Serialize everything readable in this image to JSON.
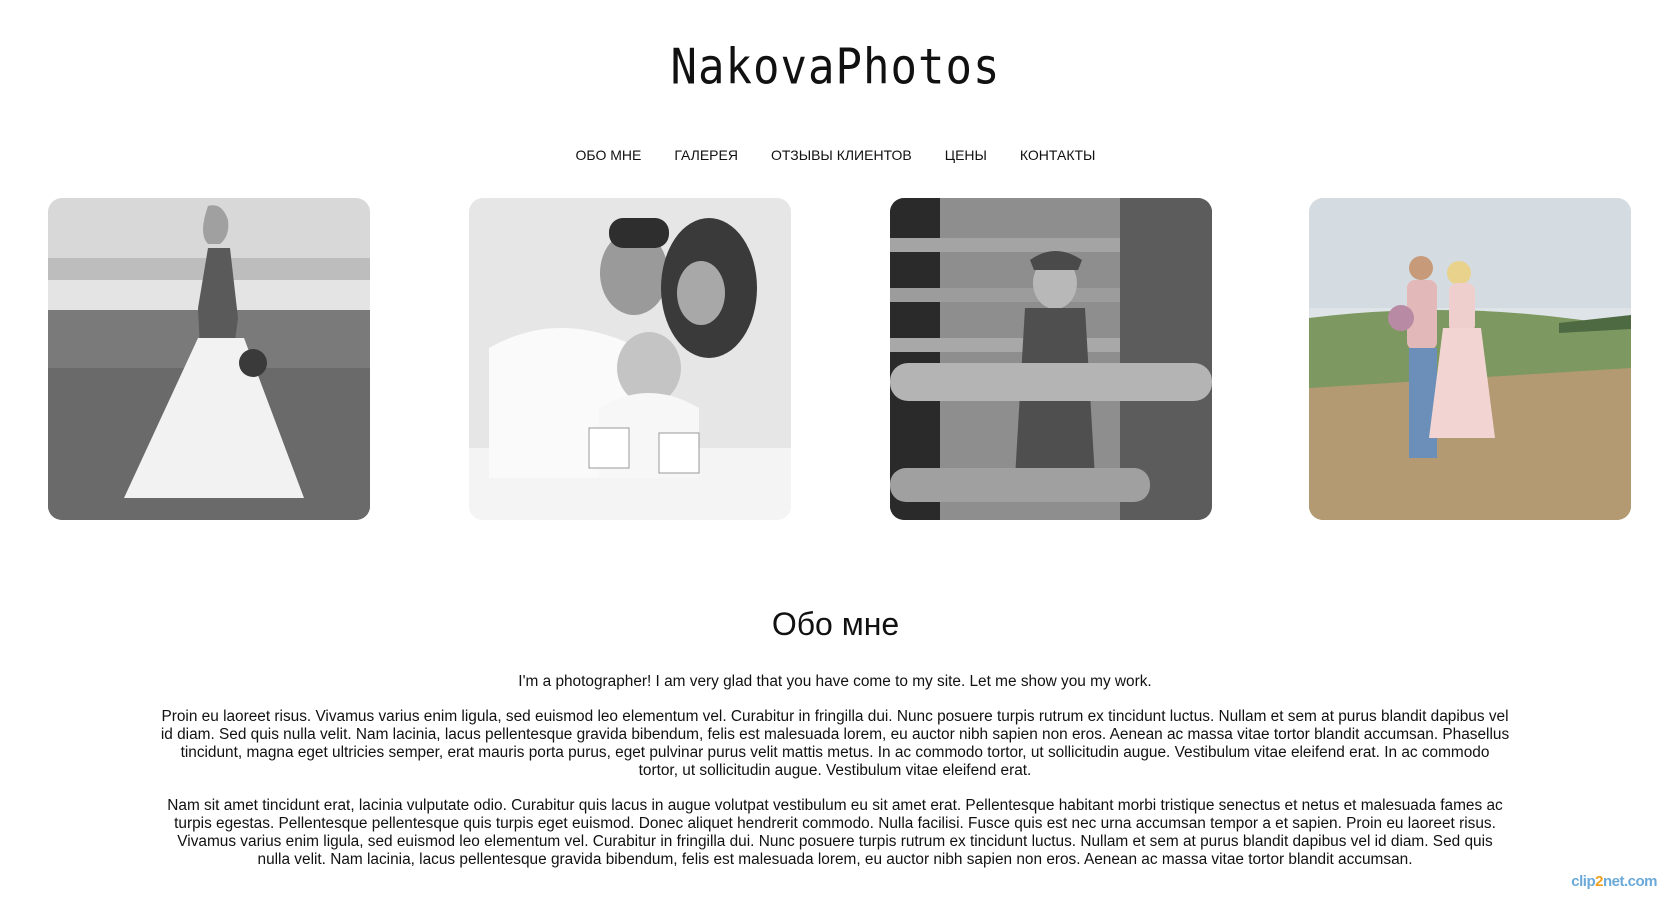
{
  "site": {
    "logo": "NakovaPhotos"
  },
  "nav": {
    "items": [
      {
        "label": "ОБО МНЕ"
      },
      {
        "label": "ГАЛЕРЕЯ"
      },
      {
        "label": "ОТЗЫВЫ КЛИЕНТОВ"
      },
      {
        "label": "ЦЕНЫ"
      },
      {
        "label": "КОНТАКТЫ"
      }
    ]
  },
  "gallery": {
    "photos": [
      {
        "icon": "bride-in-field-photo",
        "tone": "grayscale"
      },
      {
        "icon": "family-with-baby-photo",
        "tone": "grayscale"
      },
      {
        "icon": "woman-at-fence-photo",
        "tone": "grayscale"
      },
      {
        "icon": "couple-in-meadow-photo",
        "tone": "color"
      }
    ]
  },
  "about": {
    "title": "Обо мне",
    "intro": "I'm a photographer! I am very glad that you have come to my site. Let me show you my work.",
    "paragraph1": "Proin eu laoreet risus. Vivamus varius enim ligula, sed euismod leo elementum vel. Curabitur in fringilla dui. Nunc posuere turpis rutrum ex tincidunt luctus. Nullam et sem at purus blandit dapibus vel id diam. Sed quis nulla velit. Nam lacinia, lacus pellentesque gravida bibendum, felis est malesuada lorem, eu auctor nibh sapien non eros. Aenean ac massa vitae tortor blandit accumsan. Phasellus tincidunt, magna eget ultricies semper, erat mauris porta purus, eget pulvinar purus velit mattis metus. In ac commodo tortor, ut sollicitudin augue. Vestibulum vitae eleifend erat. In ac commodo tortor, ut sollicitudin augue. Vestibulum vitae eleifend erat.",
    "paragraph2": "Nam sit amet tincidunt erat, lacinia vulputate odio. Curabitur quis lacus in augue volutpat vestibulum eu sit amet erat. Pellentesque habitant morbi tristique senectus et netus et malesuada fames ac turpis egestas. Pellentesque pellentesque quis turpis eget euismod. Donec aliquet hendrerit commodo. Nulla facilisi. Fusce quis est nec urna accumsan tempor a et sapien. Proin eu laoreet risus. Vivamus varius enim ligula, sed euismod leo elementum vel. Curabitur in fringilla dui. Nunc posuere turpis rutrum ex tincidunt luctus. Nullam et sem at purus blandit dapibus vel id diam. Sed quis nulla velit. Nam lacinia, lacus pellentesque gravida bibendum, felis est malesuada lorem, eu auctor nibh sapien non eros. Aenean ac massa vitae tortor blandit accumsan."
  },
  "watermark": {
    "prefix": "clip",
    "two": "2",
    "suffix": "net.com"
  },
  "colors": {
    "text": "#111111",
    "background": "#ffffff",
    "watermark": "#6aa9d8",
    "watermark_accent": "#f0a020"
  }
}
